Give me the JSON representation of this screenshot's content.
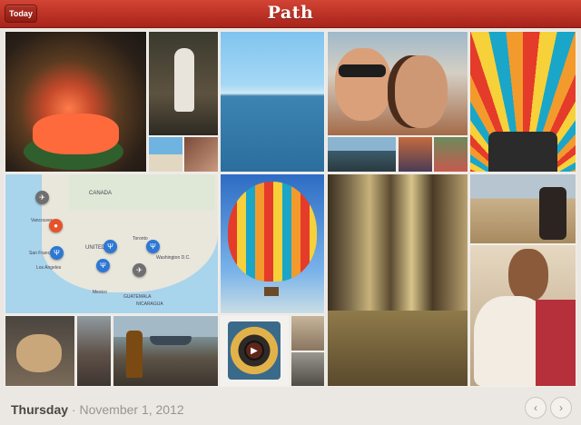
{
  "header": {
    "today_label": "Today",
    "app_name": "Path"
  },
  "map": {
    "labels": [
      "CANADA",
      "UNITED",
      "Washington D.C.",
      "Toronto",
      "San Francisco",
      "Los Angeles",
      "Vancouver",
      "Mexico",
      "GUATEMALA",
      "NICARAGUA"
    ],
    "pins": [
      "airplane-pin",
      "location-pin",
      "meal-pin",
      "meal-pin",
      "meal-pin",
      "meal-pin",
      "airplane-pin"
    ]
  },
  "footer": {
    "day": "Thursday",
    "separator": "·",
    "date": "November 1, 2012"
  },
  "nav": {
    "prev": "‹",
    "next": "›"
  },
  "colors": {
    "accent": "#c0392b",
    "background": "#ebe7e2"
  }
}
